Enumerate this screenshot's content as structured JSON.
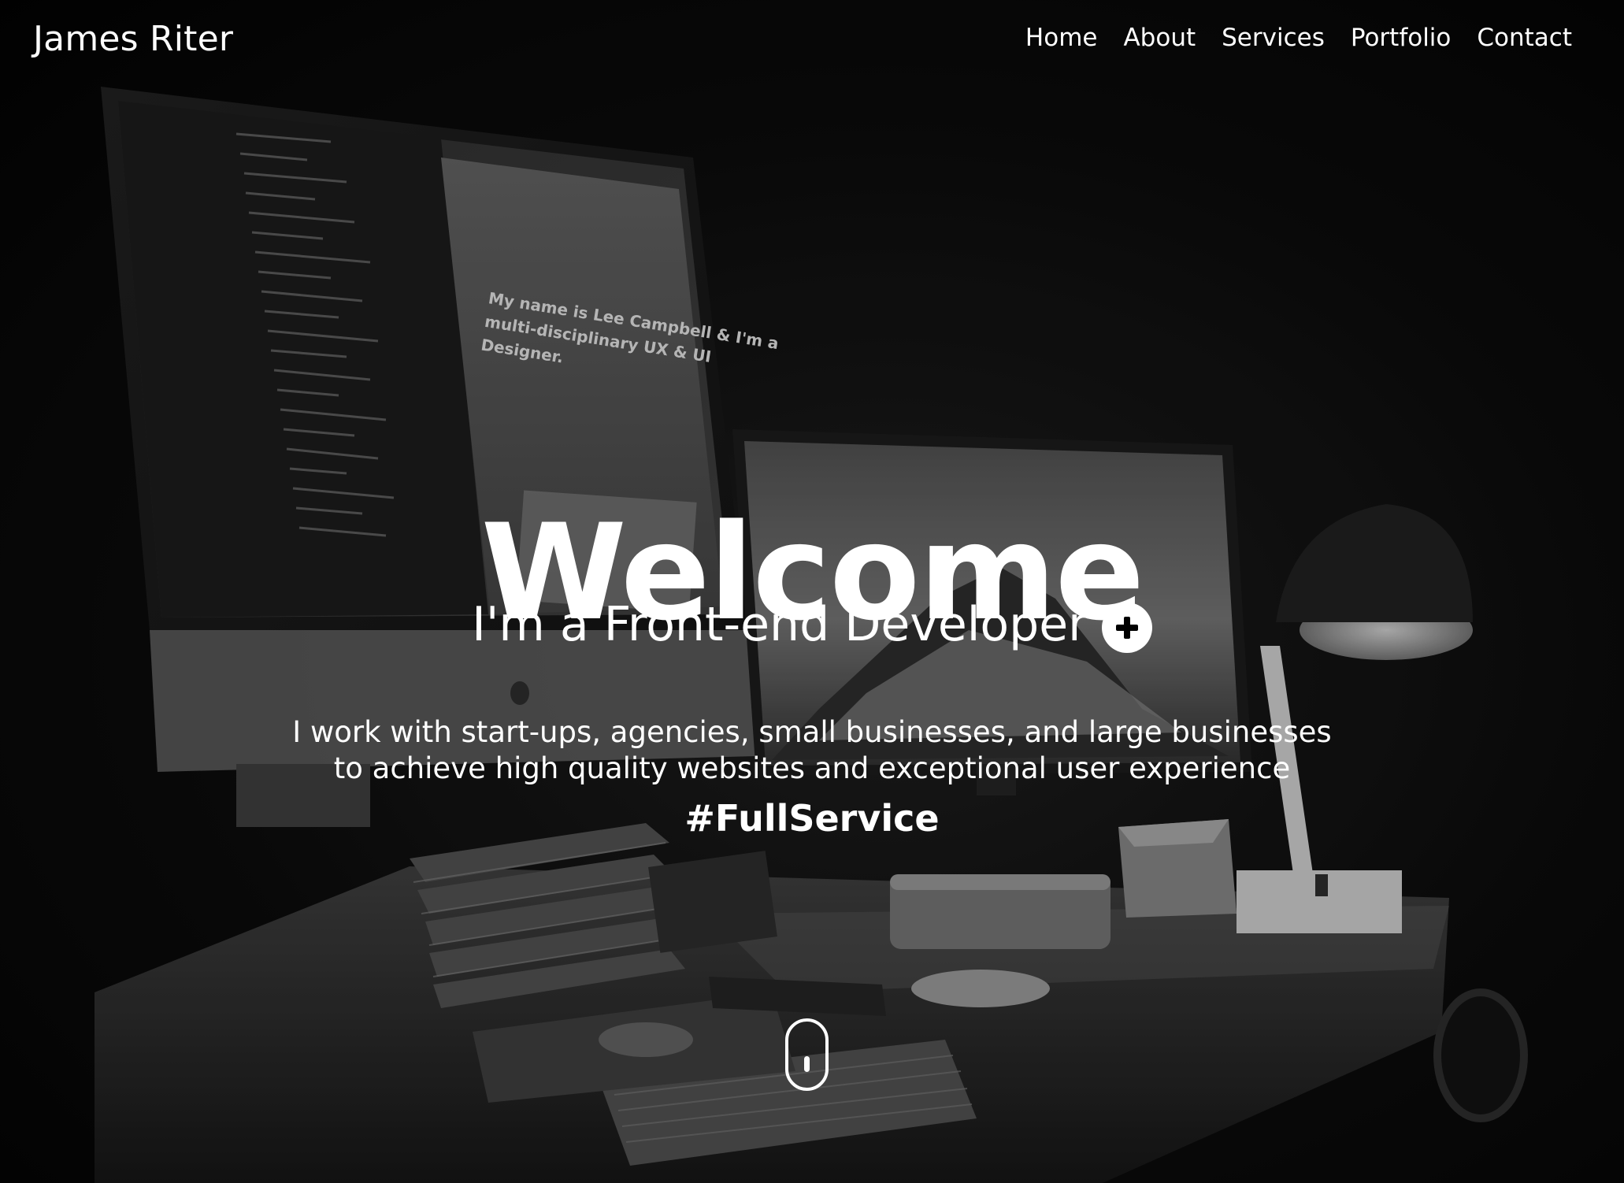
{
  "header": {
    "brand": "James Riter",
    "nav": [
      "Home",
      "About",
      "Services",
      "Portfolio",
      "Contact"
    ]
  },
  "hero": {
    "title": "Welcome",
    "role": "I'm a Front-end Developer",
    "role_action_icon": "plus-circle-icon",
    "intro_lines": [
      "I work with start-ups, agencies, small businesses, and large businesses",
      "to achieve high quality websites and exceptional user experience"
    ],
    "hashtag": "#FullService",
    "scroll_icon": "mouse-scroll-icon",
    "background_image": "dark desk workspace with monitors, lamp, keyboard, mouse",
    "screen_text": [
      "My name is Lee Campbell & I'm a",
      "multi-disciplinary UX & UI",
      "Designer."
    ]
  },
  "colors": {
    "text": "#ffffff",
    "background": "#000000"
  }
}
